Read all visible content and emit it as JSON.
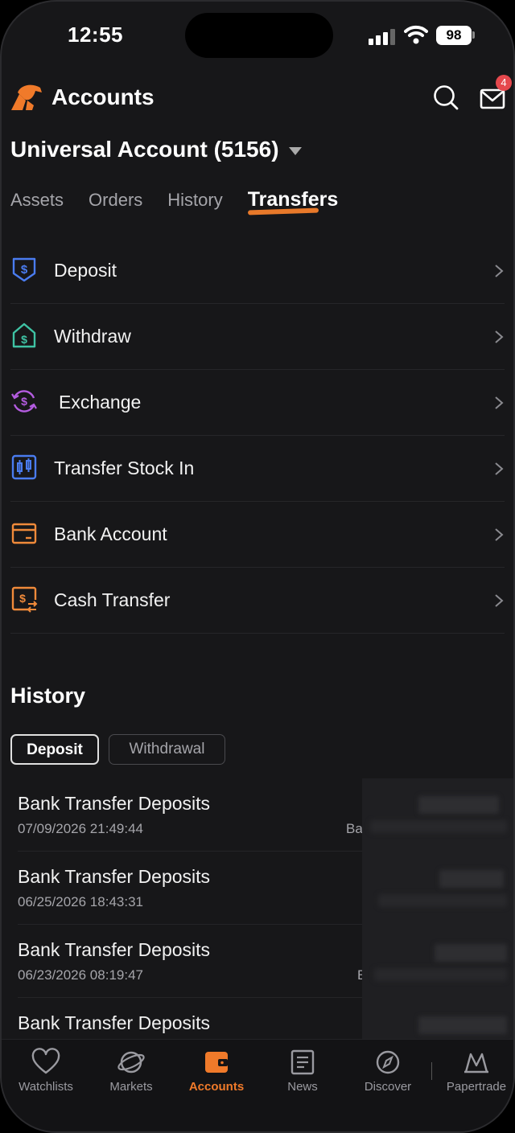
{
  "status_bar": {
    "time": "12:55",
    "battery": "98"
  },
  "header": {
    "title": "Accounts",
    "mail_badge": "4"
  },
  "account": {
    "name": "Universal Account (5156)"
  },
  "tabs": [
    {
      "label": "Assets"
    },
    {
      "label": "Orders"
    },
    {
      "label": "History"
    },
    {
      "label": "Transfers",
      "active": true
    }
  ],
  "menu": [
    {
      "label": "Deposit",
      "icon": "deposit-icon",
      "color": "#4a7cf0"
    },
    {
      "label": "Withdraw",
      "icon": "withdraw-icon",
      "color": "#3fc3a4"
    },
    {
      "label": "Exchange",
      "icon": "exchange-icon",
      "color": "#b45ce0"
    },
    {
      "label": "Transfer Stock In",
      "icon": "transfer-stock-icon",
      "color": "#4a7cf0"
    },
    {
      "label": "Bank Account",
      "icon": "bank-card-icon",
      "color": "#f08a3a"
    },
    {
      "label": "Cash Transfer",
      "icon": "cash-transfer-icon",
      "color": "#f08a3a"
    }
  ],
  "history": {
    "title": "History",
    "filters": [
      {
        "label": "Deposit",
        "active": true
      },
      {
        "label": "Withdrawal",
        "active": false
      }
    ],
    "transactions": [
      {
        "title": "Bank Transfer Deposits",
        "date": "07/09/2026 21:49:44",
        "extra": "Ba"
      },
      {
        "title": "Bank Transfer Deposits",
        "date": "06/25/2026 18:43:31",
        "extra": ""
      },
      {
        "title": "Bank Transfer Deposits",
        "date": "06/23/2026 08:19:47",
        "extra": "E"
      },
      {
        "title": "Bank Transfer Deposits",
        "date": "",
        "extra": ""
      }
    ]
  },
  "bottom_nav": [
    {
      "label": "Watchlists",
      "icon": "heart-icon"
    },
    {
      "label": "Markets",
      "icon": "planet-icon"
    },
    {
      "label": "Accounts",
      "icon": "wallet-icon",
      "active": true
    },
    {
      "label": "News",
      "icon": "news-icon"
    },
    {
      "label": "Discover",
      "icon": "compass-icon"
    },
    {
      "label": "Papertrade",
      "icon": "papertrade-icon"
    }
  ],
  "colors": {
    "accent": "#f07a2a",
    "background": "#171719",
    "badge": "#e5484d"
  }
}
